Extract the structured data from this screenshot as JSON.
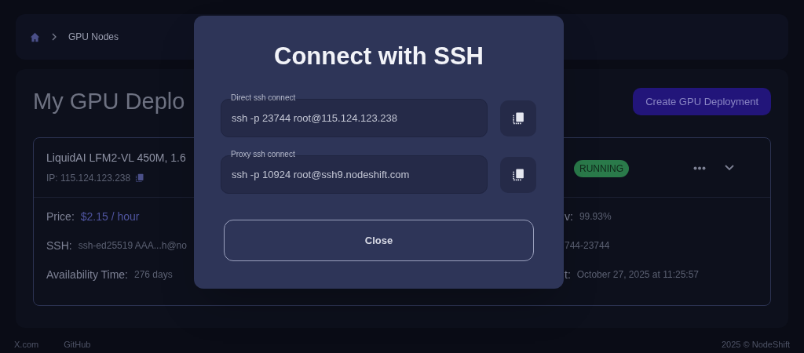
{
  "breadcrumb": {
    "current": "GPU Nodes"
  },
  "page": {
    "title": "My GPU Deplo",
    "create_button": "Create GPU Deployment"
  },
  "deployment": {
    "name": "LiquidAI LFM2-VL 450M, 1.6",
    "ip": "IP: 115.124.123.238",
    "status": "RUNNING",
    "left_details": [
      {
        "label": "Price:",
        "value": "$2.15 / hour",
        "kind": "accent"
      },
      {
        "label": "SSH:",
        "value": "ssh-ed25519 AAA...h@no",
        "kind": "plain"
      },
      {
        "label": "Availability Time:",
        "value": "276 days",
        "kind": "plain"
      }
    ],
    "right_details": [
      {
        "label": "v:",
        "value": "99.93%"
      },
      {
        "value": "744-23744"
      },
      {
        "label": "t:",
        "value": "October 27, 2025 at 11:25:57"
      }
    ]
  },
  "dialog": {
    "title": "Connect with SSH",
    "fields": [
      {
        "label": "Direct ssh connect",
        "value": "ssh -p 23744 root@115.124.123.238"
      },
      {
        "label": "Proxy ssh connect",
        "value": "ssh -p 10924 root@ssh9.nodeshift.com"
      }
    ],
    "close_button": "Close"
  },
  "footer": {
    "links": [
      "X.com",
      "GitHub"
    ],
    "copyright": "2025 © NodeShift"
  }
}
